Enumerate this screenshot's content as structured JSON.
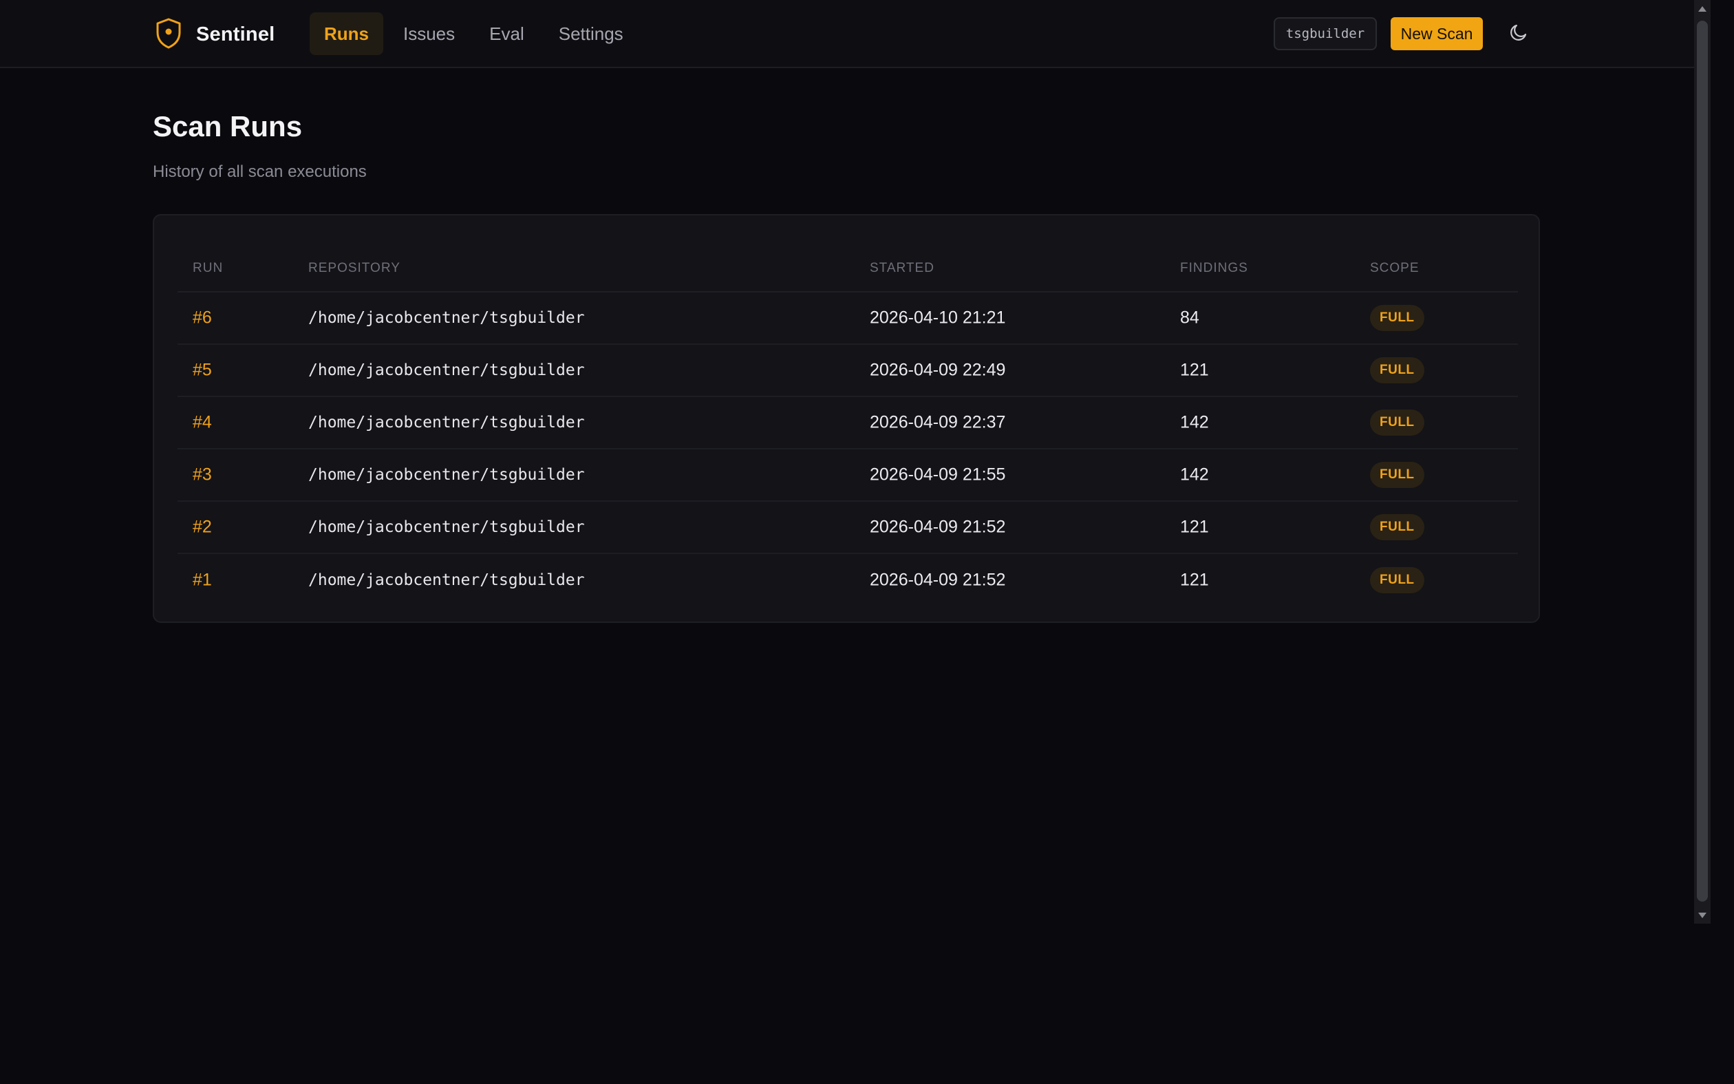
{
  "app": {
    "name": "Sentinel",
    "accent": "#f0a21a"
  },
  "nav": {
    "tabs": [
      {
        "label": "Runs",
        "active": true
      },
      {
        "label": "Issues",
        "active": false
      },
      {
        "label": "Eval",
        "active": false
      },
      {
        "label": "Settings",
        "active": false
      }
    ]
  },
  "header": {
    "repo_chip": "tsgbuilder",
    "new_scan_label": "New Scan",
    "theme_icon": "moon-icon"
  },
  "page": {
    "title": "Scan Runs",
    "subtitle": "History of all scan executions"
  },
  "table": {
    "columns": [
      "RUN",
      "REPOSITORY",
      "STARTED",
      "FINDINGS",
      "SCOPE"
    ],
    "rows": [
      {
        "run": "#6",
        "repo": "/home/jacobcentner/tsgbuilder",
        "started": "2026-04-10 21:21",
        "findings": "84",
        "scope": "FULL"
      },
      {
        "run": "#5",
        "repo": "/home/jacobcentner/tsgbuilder",
        "started": "2026-04-09 22:49",
        "findings": "121",
        "scope": "FULL"
      },
      {
        "run": "#4",
        "repo": "/home/jacobcentner/tsgbuilder",
        "started": "2026-04-09 22:37",
        "findings": "142",
        "scope": "FULL"
      },
      {
        "run": "#3",
        "repo": "/home/jacobcentner/tsgbuilder",
        "started": "2026-04-09 21:55",
        "findings": "142",
        "scope": "FULL"
      },
      {
        "run": "#2",
        "repo": "/home/jacobcentner/tsgbuilder",
        "started": "2026-04-09 21:52",
        "findings": "121",
        "scope": "FULL"
      },
      {
        "run": "#1",
        "repo": "/home/jacobcentner/tsgbuilder",
        "started": "2026-04-09 21:52",
        "findings": "121",
        "scope": "FULL"
      }
    ]
  }
}
